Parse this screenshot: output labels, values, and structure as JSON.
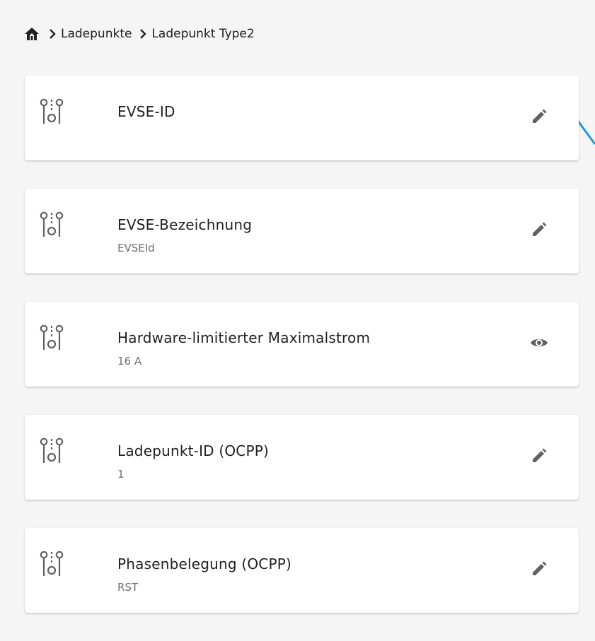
{
  "breadcrumb": {
    "home_icon": "home-icon",
    "separator_icon": "chevron-right-icon",
    "items": [
      "Ladepunkte",
      "Ladepunkt Type2"
    ]
  },
  "settings": [
    {
      "title": "EVSE-ID",
      "value": "",
      "icon": "settings-sliders-icon",
      "action": "edit-pencil-icon"
    },
    {
      "title": "EVSE-Bezeichnung",
      "value": "EVSEId",
      "icon": "settings-sliders-icon",
      "action": "edit-pencil-icon"
    },
    {
      "title": "Hardware-limitierter Maximalstrom",
      "value": "16 A",
      "icon": "settings-sliders-icon",
      "action": "view-eye-icon"
    },
    {
      "title": "Ladepunkt-ID (OCPP)",
      "value": "1",
      "icon": "settings-sliders-icon",
      "action": "edit-pencil-icon"
    },
    {
      "title": "Phasenbelegung (OCPP)",
      "value": "RST",
      "icon": "settings-sliders-icon",
      "action": "edit-pencil-icon"
    }
  ],
  "colors": {
    "background": "#f5f5f5",
    "card": "#ffffff",
    "icon": "#616161",
    "accent_line": "#1e9ad6"
  }
}
